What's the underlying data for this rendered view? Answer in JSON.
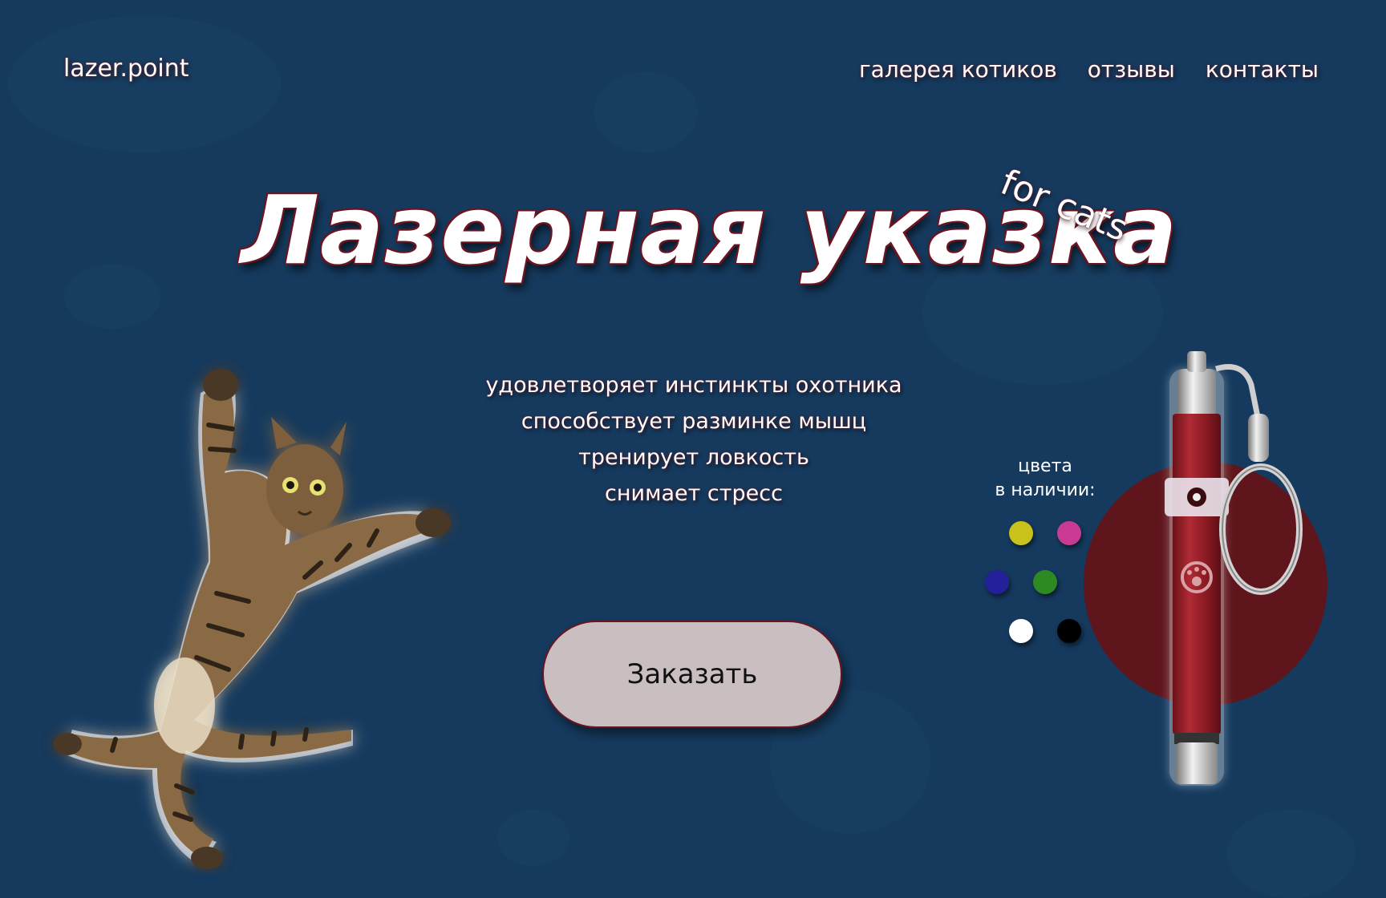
{
  "header": {
    "logo": "lazer.point",
    "nav": [
      "галерея котиков",
      "отзывы",
      "контакты"
    ]
  },
  "hero": {
    "title": "Лазерная указка",
    "tag": "for cats",
    "features": [
      "удовлетворяет инстинкты охотника",
      "способствует разминке мышц",
      "тренирует ловкость",
      "снимает стресс"
    ],
    "order_button": "Заказать"
  },
  "colors": {
    "label_line1": "цвета",
    "label_line2": "в наличии:",
    "swatches": [
      {
        "name": "yellow",
        "hex": "#c8c21a"
      },
      {
        "name": "pink",
        "hex": "#c93a92"
      },
      {
        "name": "blue",
        "hex": "#23209a"
      },
      {
        "name": "green",
        "hex": "#2d8a23"
      },
      {
        "name": "white",
        "hex": "#ffffff"
      },
      {
        "name": "black",
        "hex": "#000000"
      }
    ]
  },
  "theme": {
    "background": "#153a5e",
    "accent": "#5e161c",
    "button_bg": "#c9bfc1"
  }
}
